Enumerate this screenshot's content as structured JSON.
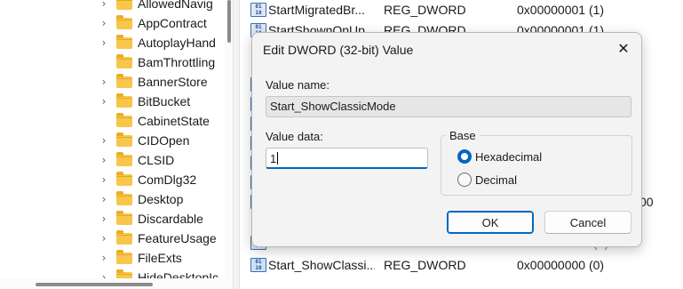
{
  "tree": {
    "items": [
      {
        "label": "AllowedNavig",
        "expandable": true
      },
      {
        "label": "AppContract",
        "expandable": true
      },
      {
        "label": "AutoplayHand",
        "expandable": true
      },
      {
        "label": "BamThrottling",
        "expandable": false
      },
      {
        "label": "BannerStore",
        "expandable": true
      },
      {
        "label": "BitBucket",
        "expandable": true
      },
      {
        "label": "CabinetState",
        "expandable": false
      },
      {
        "label": "CIDOpen",
        "expandable": true
      },
      {
        "label": "CLSID",
        "expandable": true
      },
      {
        "label": "ComDlg32",
        "expandable": true
      },
      {
        "label": "Desktop",
        "expandable": true
      },
      {
        "label": "Discardable",
        "expandable": true
      },
      {
        "label": "FeatureUsage",
        "expandable": true
      },
      {
        "label": "FileExts",
        "expandable": true
      },
      {
        "label": "HideDesktopIc",
        "expandable": true
      }
    ]
  },
  "values": {
    "rows": [
      {
        "name": "StartMigratedBr...",
        "type": "REG_DWORD",
        "data": "0x00000001 (1)"
      },
      {
        "name": "StartShownOnUp...",
        "type": "REG_DWORD",
        "data": "0x00000001 (1)"
      }
    ],
    "partial_data_right": "00",
    "partial_data_paren": "(0)",
    "bottom_row": {
      "name": "Start_ShowClassi...",
      "type": "REG_DWORD",
      "data": "0x00000000 (0)"
    }
  },
  "dialog": {
    "title": "Edit DWORD (32-bit) Value",
    "close_glyph": "✕",
    "value_name_label": "Value name:",
    "value_name": "Start_ShowClassicMode",
    "value_data_label": "Value data:",
    "value_data": "1",
    "base_label": "Base",
    "base_options": [
      {
        "label": "Hexadecimal",
        "selected": true
      },
      {
        "label": "Decimal",
        "selected": false
      }
    ],
    "ok_label": "OK",
    "cancel_label": "Cancel"
  },
  "icons": {
    "reg_value_icon_text": "011\n110\n010",
    "tree_chevron": "›",
    "folder_color": "#f8c64a"
  },
  "colors": {
    "accent": "#0067c0",
    "dialog_background": "#f3f3f3"
  }
}
